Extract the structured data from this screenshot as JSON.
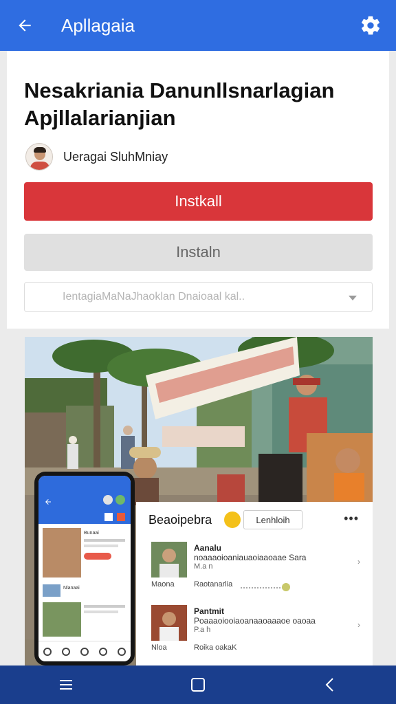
{
  "appbar": {
    "title": "Apllagaia",
    "back_icon": "arrow-back-icon",
    "settings_icon": "gear-icon",
    "color": "#2f6de1"
  },
  "app": {
    "title": "Nesakriania Danunllsnarlagian Apjllalarianjian",
    "developer": "Ueragai SluhMniay"
  },
  "buttons": {
    "install_label": "Instkall",
    "install_color": "#d9363a",
    "secondary_label": "Instaln"
  },
  "select": {
    "value": "IentagiaMaNaJhaoklan Dnaioaal kal.."
  },
  "phone_preview": {
    "label_1": "Bunaai",
    "label_2": "Nlanaai"
  },
  "feed": {
    "header": "Beaoipebra",
    "chip_label": "Lenhloih",
    "more_icon": "more-horizontal-icon",
    "items": [
      {
        "title": "Aanalu",
        "line": "noaaaoioaniauaoiaaoaae Sara",
        "sub": "M.a n",
        "meta_left": "Maona",
        "meta_right": "Raotanarlia"
      },
      {
        "title": "Pantmit",
        "line": "Poaaaoiooiaoanaaoaaaoe oaoaa",
        "sub": "P.a h",
        "meta_left": "Nloa",
        "meta_right": "Roika oakaK"
      }
    ]
  },
  "navbar": {
    "menu_icon": "recents-icon",
    "home_icon": "home-icon",
    "back_icon": "back-triangle-icon",
    "color": "#1a3e8d"
  }
}
